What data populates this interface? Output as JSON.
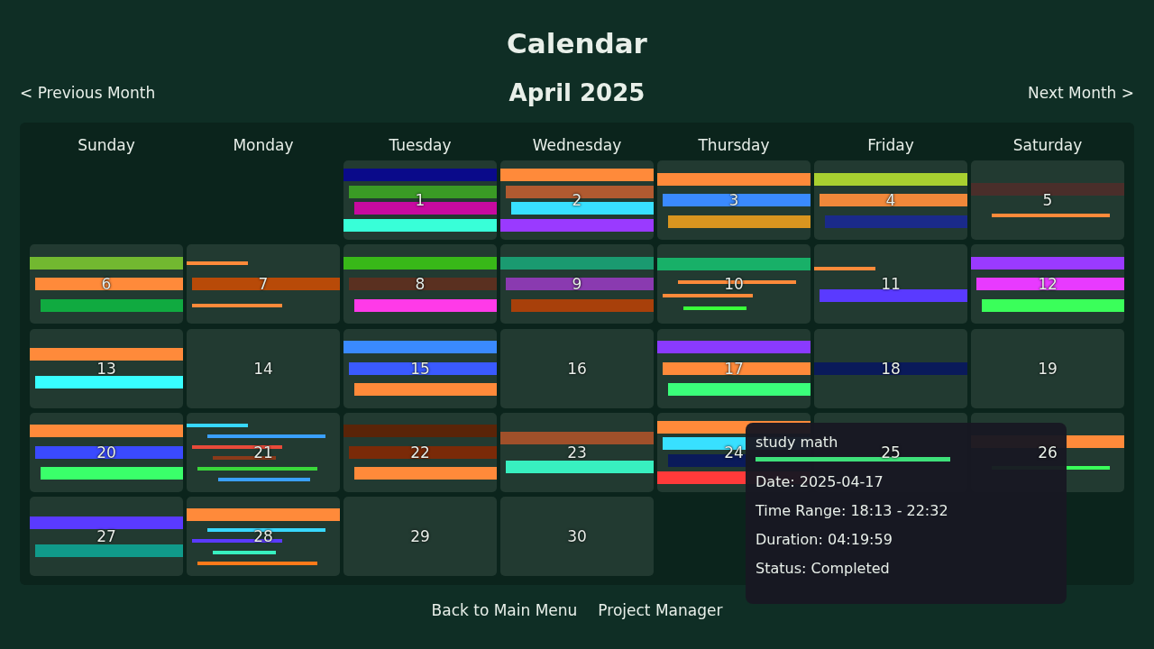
{
  "title": "Calendar",
  "nav": {
    "previous": "< Previous Month",
    "month": "April 2025",
    "next": "Next Month >"
  },
  "weekdays": [
    "Sunday",
    "Monday",
    "Tuesday",
    "Wednesday",
    "Thursday",
    "Friday",
    "Saturday"
  ],
  "days": [
    {
      "kind": "blank"
    },
    {
      "kind": "blank"
    },
    {
      "kind": "day",
      "day": "1",
      "blocks": [
        {
          "kind": "band",
          "color": "#0a0a8a"
        },
        {
          "kind": "band",
          "color": "#3a9a25"
        },
        {
          "kind": "band",
          "color": "#c80aa0"
        },
        {
          "kind": "band",
          "color": "#38ffd8"
        }
      ]
    },
    {
      "kind": "day",
      "day": "2",
      "blocks": [
        {
          "kind": "band",
          "color": "#ff8a3a"
        },
        {
          "kind": "band",
          "color": "#b05a30"
        },
        {
          "kind": "band",
          "color": "#38e0ff"
        },
        {
          "kind": "band",
          "color": "#9a3aff"
        }
      ]
    },
    {
      "kind": "day",
      "day": "3",
      "blocks": [
        {
          "kind": "band",
          "color": "#ff8a3a"
        },
        {
          "kind": "band",
          "color": "#3a8aff"
        },
        {
          "kind": "band",
          "color": "#d9951f"
        }
      ]
    },
    {
      "kind": "day",
      "day": "4",
      "blocks": [
        {
          "kind": "band",
          "color": "#a8d030"
        },
        {
          "kind": "band",
          "color": "#f0883a"
        },
        {
          "kind": "band",
          "color": "#1a2a8a"
        }
      ]
    },
    {
      "kind": "day",
      "day": "5",
      "blocks": [
        {
          "kind": "band",
          "color": "#4a2e2a"
        },
        {
          "kind": "line",
          "color": "#ff8a3a"
        }
      ]
    },
    {
      "kind": "day",
      "day": "6",
      "blocks": [
        {
          "kind": "band",
          "color": "#72b830"
        },
        {
          "kind": "band",
          "color": "#ff8a3a"
        },
        {
          "kind": "band",
          "color": "#10aa40"
        }
      ]
    },
    {
      "kind": "day",
      "day": "7",
      "blocks": [
        {
          "kind": "line",
          "color": "#ff8a3a"
        },
        {
          "kind": "band",
          "color": "#b84a08"
        },
        {
          "kind": "line",
          "color": "#ff8a3a"
        }
      ]
    },
    {
      "kind": "day",
      "day": "8",
      "blocks": [
        {
          "kind": "band",
          "color": "#38b818"
        },
        {
          "kind": "band",
          "color": "#5a3020"
        },
        {
          "kind": "band",
          "color": "#ff3ae8"
        }
      ]
    },
    {
      "kind": "day",
      "day": "9",
      "blocks": [
        {
          "kind": "band",
          "color": "#1a9a70"
        },
        {
          "kind": "band",
          "color": "#8a3ab0"
        },
        {
          "kind": "band",
          "color": "#a8400a"
        }
      ]
    },
    {
      "kind": "day",
      "day": "10",
      "blocks": [
        {
          "kind": "band",
          "color": "#18b068"
        },
        {
          "kind": "line",
          "color": "#ff8a3a"
        },
        {
          "kind": "line",
          "color": "#ff8a3a"
        },
        {
          "kind": "line",
          "color": "#3aff3a"
        }
      ]
    },
    {
      "kind": "day",
      "day": "11",
      "blocks": [
        {
          "kind": "line",
          "color": "#ff8a3a"
        },
        {
          "kind": "band",
          "color": "#5a3aff"
        }
      ]
    },
    {
      "kind": "day",
      "day": "12",
      "blocks": [
        {
          "kind": "band",
          "color": "#9a3aff"
        },
        {
          "kind": "band",
          "color": "#e83aff"
        },
        {
          "kind": "band",
          "color": "#3aff5a"
        }
      ]
    },
    {
      "kind": "day",
      "day": "13",
      "blocks": [
        {
          "kind": "band",
          "color": "#ff8a3a"
        },
        {
          "kind": "band",
          "color": "#38ffff"
        }
      ]
    },
    {
      "kind": "day",
      "day": "14"
    },
    {
      "kind": "day",
      "day": "15",
      "blocks": [
        {
          "kind": "band",
          "color": "#3a8aff"
        },
        {
          "kind": "band",
          "color": "#3a5aff"
        },
        {
          "kind": "band",
          "color": "#ff8a3a"
        }
      ]
    },
    {
      "kind": "day",
      "day": "16"
    },
    {
      "kind": "day",
      "day": "17",
      "blocks": [
        {
          "kind": "band",
          "color": "#8a3aff"
        },
        {
          "kind": "band",
          "color": "#ff8a3a"
        },
        {
          "kind": "band",
          "color": "#3aff7a"
        }
      ]
    },
    {
      "kind": "day",
      "day": "18",
      "blocks": [
        {
          "kind": "band",
          "color": "#0a1a5a"
        }
      ]
    },
    {
      "kind": "day",
      "day": "19"
    },
    {
      "kind": "day",
      "day": "20",
      "blocks": [
        {
          "kind": "band",
          "color": "#ff8a3a"
        },
        {
          "kind": "band",
          "color": "#3a4aff"
        },
        {
          "kind": "band",
          "color": "#3aff6a"
        }
      ]
    },
    {
      "kind": "day",
      "day": "21",
      "blocks": [
        {
          "kind": "line",
          "color": "#38d8ff"
        },
        {
          "kind": "line",
          "color": "#3aa0ff"
        },
        {
          "kind": "line",
          "color": "#e84a3a"
        },
        {
          "kind": "line",
          "color": "#8a3a1a"
        },
        {
          "kind": "line",
          "color": "#3ad83a"
        },
        {
          "kind": "line",
          "color": "#3aa0ff"
        }
      ]
    },
    {
      "kind": "day",
      "day": "22",
      "blocks": [
        {
          "kind": "band",
          "color": "#5a2408"
        },
        {
          "kind": "band",
          "color": "#7a2a08"
        },
        {
          "kind": "band",
          "color": "#ff8a3a"
        }
      ]
    },
    {
      "kind": "day",
      "day": "23",
      "blocks": [
        {
          "kind": "band",
          "color": "#a0502a"
        },
        {
          "kind": "band",
          "color": "#38f0c0"
        }
      ]
    },
    {
      "kind": "day",
      "day": "24",
      "blocks": [
        {
          "kind": "band",
          "color": "#ff8a3a"
        },
        {
          "kind": "band",
          "color": "#38e0ff"
        },
        {
          "kind": "band",
          "color": "#0a1a5a"
        },
        {
          "kind": "band",
          "color": "#ff3a3a"
        }
      ]
    },
    {
      "kind": "day",
      "day": "25"
    },
    {
      "kind": "day",
      "day": "26",
      "blocks": [
        {
          "kind": "band",
          "color": "#ff8a3a"
        },
        {
          "kind": "line",
          "color": "#3aff5a"
        }
      ]
    },
    {
      "kind": "day",
      "day": "27",
      "blocks": [
        {
          "kind": "band",
          "color": "#5a3aff"
        },
        {
          "kind": "band",
          "color": "#109a8a"
        }
      ]
    },
    {
      "kind": "day",
      "day": "28",
      "blocks": [
        {
          "kind": "band",
          "color": "#ff8a3a"
        },
        {
          "kind": "line",
          "color": "#38d8ff"
        },
        {
          "kind": "line",
          "color": "#5a3aff"
        },
        {
          "kind": "line",
          "color": "#38f0c0"
        },
        {
          "kind": "line",
          "color": "#ff7a1a"
        }
      ]
    },
    {
      "kind": "day",
      "day": "29"
    },
    {
      "kind": "day",
      "day": "30"
    }
  ],
  "tooltip": {
    "title": "study math",
    "lines": [
      "Date: 2025-04-17",
      "Time Range: 18:13 - 22:32",
      "Duration: 04:19:59",
      "Status: Completed"
    ]
  },
  "footer": [
    "Back to Main Menu",
    "Project Manager"
  ]
}
